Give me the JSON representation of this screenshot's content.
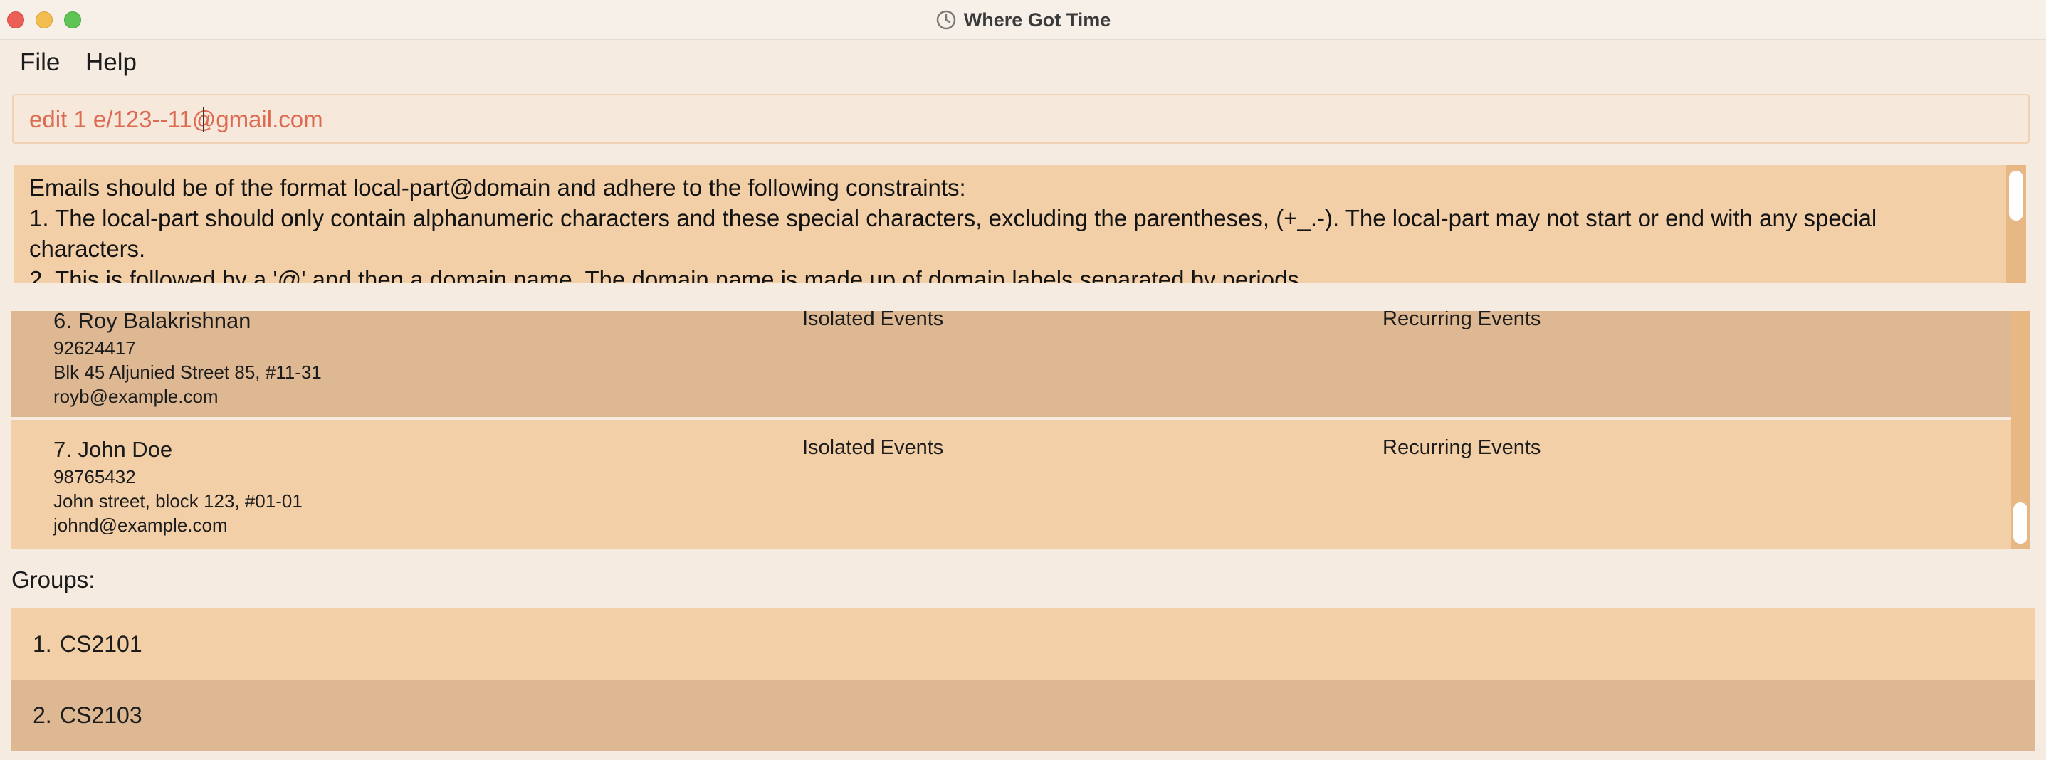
{
  "window": {
    "title": "Where Got Time",
    "icon": "clock-icon"
  },
  "menu": {
    "file_label": "File",
    "help_label": "Help"
  },
  "command": {
    "value": "edit 1 e/123--11@gmail.com"
  },
  "result": {
    "text": "Emails should be of the format local-part@domain and adhere to the following constraints:\n1. The local-part should only contain alphanumeric characters and these special characters, excluding the parentheses, (+_.-). The local-part may not start or end with any special characters.\n2. This is followed by a '@' and then a domain name. The domain name is made up of domain labels separated by periods.\nThe domain name must:"
  },
  "persons": [
    {
      "index_name": "6. Roy Balakrishnan",
      "phone": "92624417",
      "address": "Blk 45 Aljunied Street 85, #11-31",
      "email": "royb@example.com",
      "isolated_label": "Isolated Events",
      "recurring_label": "Recurring Events"
    },
    {
      "index_name": "7. John Doe",
      "phone": "98765432",
      "address": "John street, block 123, #01-01",
      "email": "johnd@example.com",
      "isolated_label": "Isolated Events",
      "recurring_label": "Recurring Events"
    }
  ],
  "groups": {
    "label": "Groups:",
    "items": [
      {
        "index": "1.",
        "name": "CS2101"
      },
      {
        "index": "2.",
        "name": "CS2103"
      }
    ]
  },
  "colors": {
    "background": "#f6ebe0",
    "card_light": "#f2cfa7",
    "card_dark": "#ddb893",
    "command_text": "#dc6b52",
    "scroll_track": "#e8b884"
  }
}
